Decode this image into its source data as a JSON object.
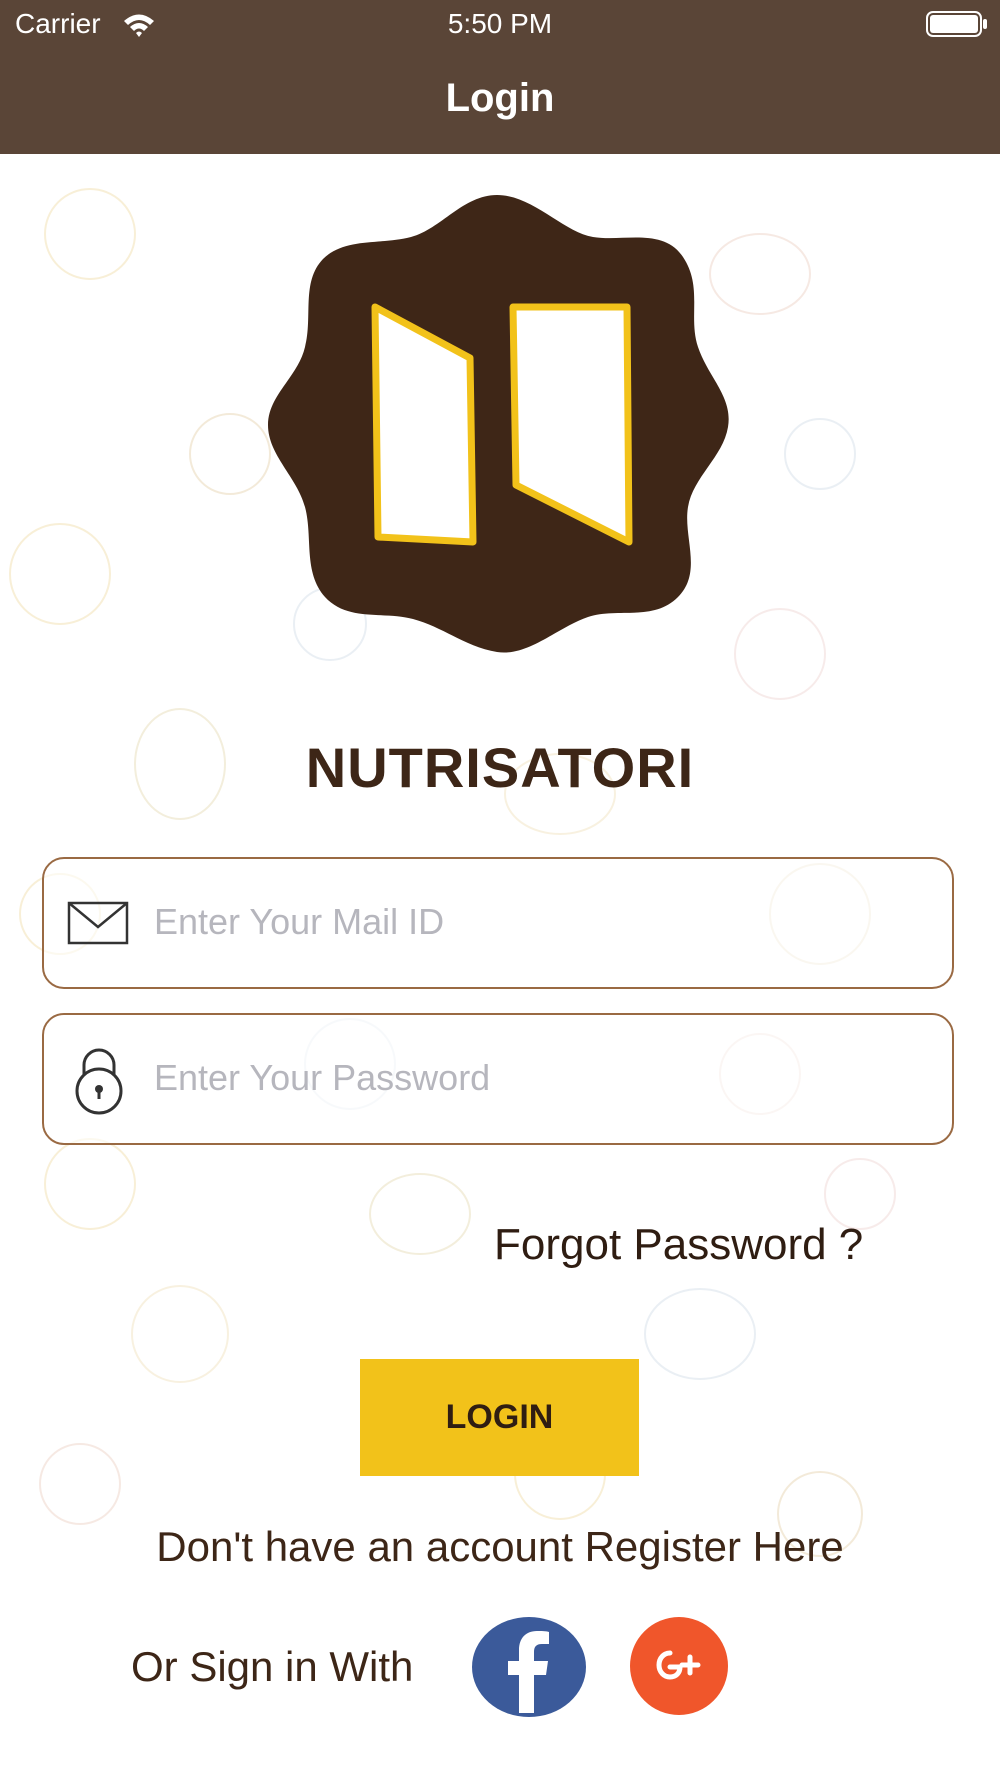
{
  "status_bar": {
    "carrier": "Carrier",
    "time": "5:50 PM"
  },
  "nav": {
    "title": "Login"
  },
  "app": {
    "name": "NUTRISATORI"
  },
  "form": {
    "email_placeholder": "Enter Your Mail ID",
    "password_placeholder": "Enter Your Password",
    "forgot_label": "Forgot Password ?",
    "login_label": "LOGIN"
  },
  "register_text": "Don't have an account Register Here",
  "social": {
    "label": "Or Sign in With",
    "icons": [
      "facebook-icon",
      "google-plus-icon"
    ]
  },
  "colors": {
    "bar": "#5a4537",
    "accent": "#f2c21a",
    "logo": "#3e2617",
    "facebook": "#3b5a9a",
    "google": "#f0562b"
  }
}
